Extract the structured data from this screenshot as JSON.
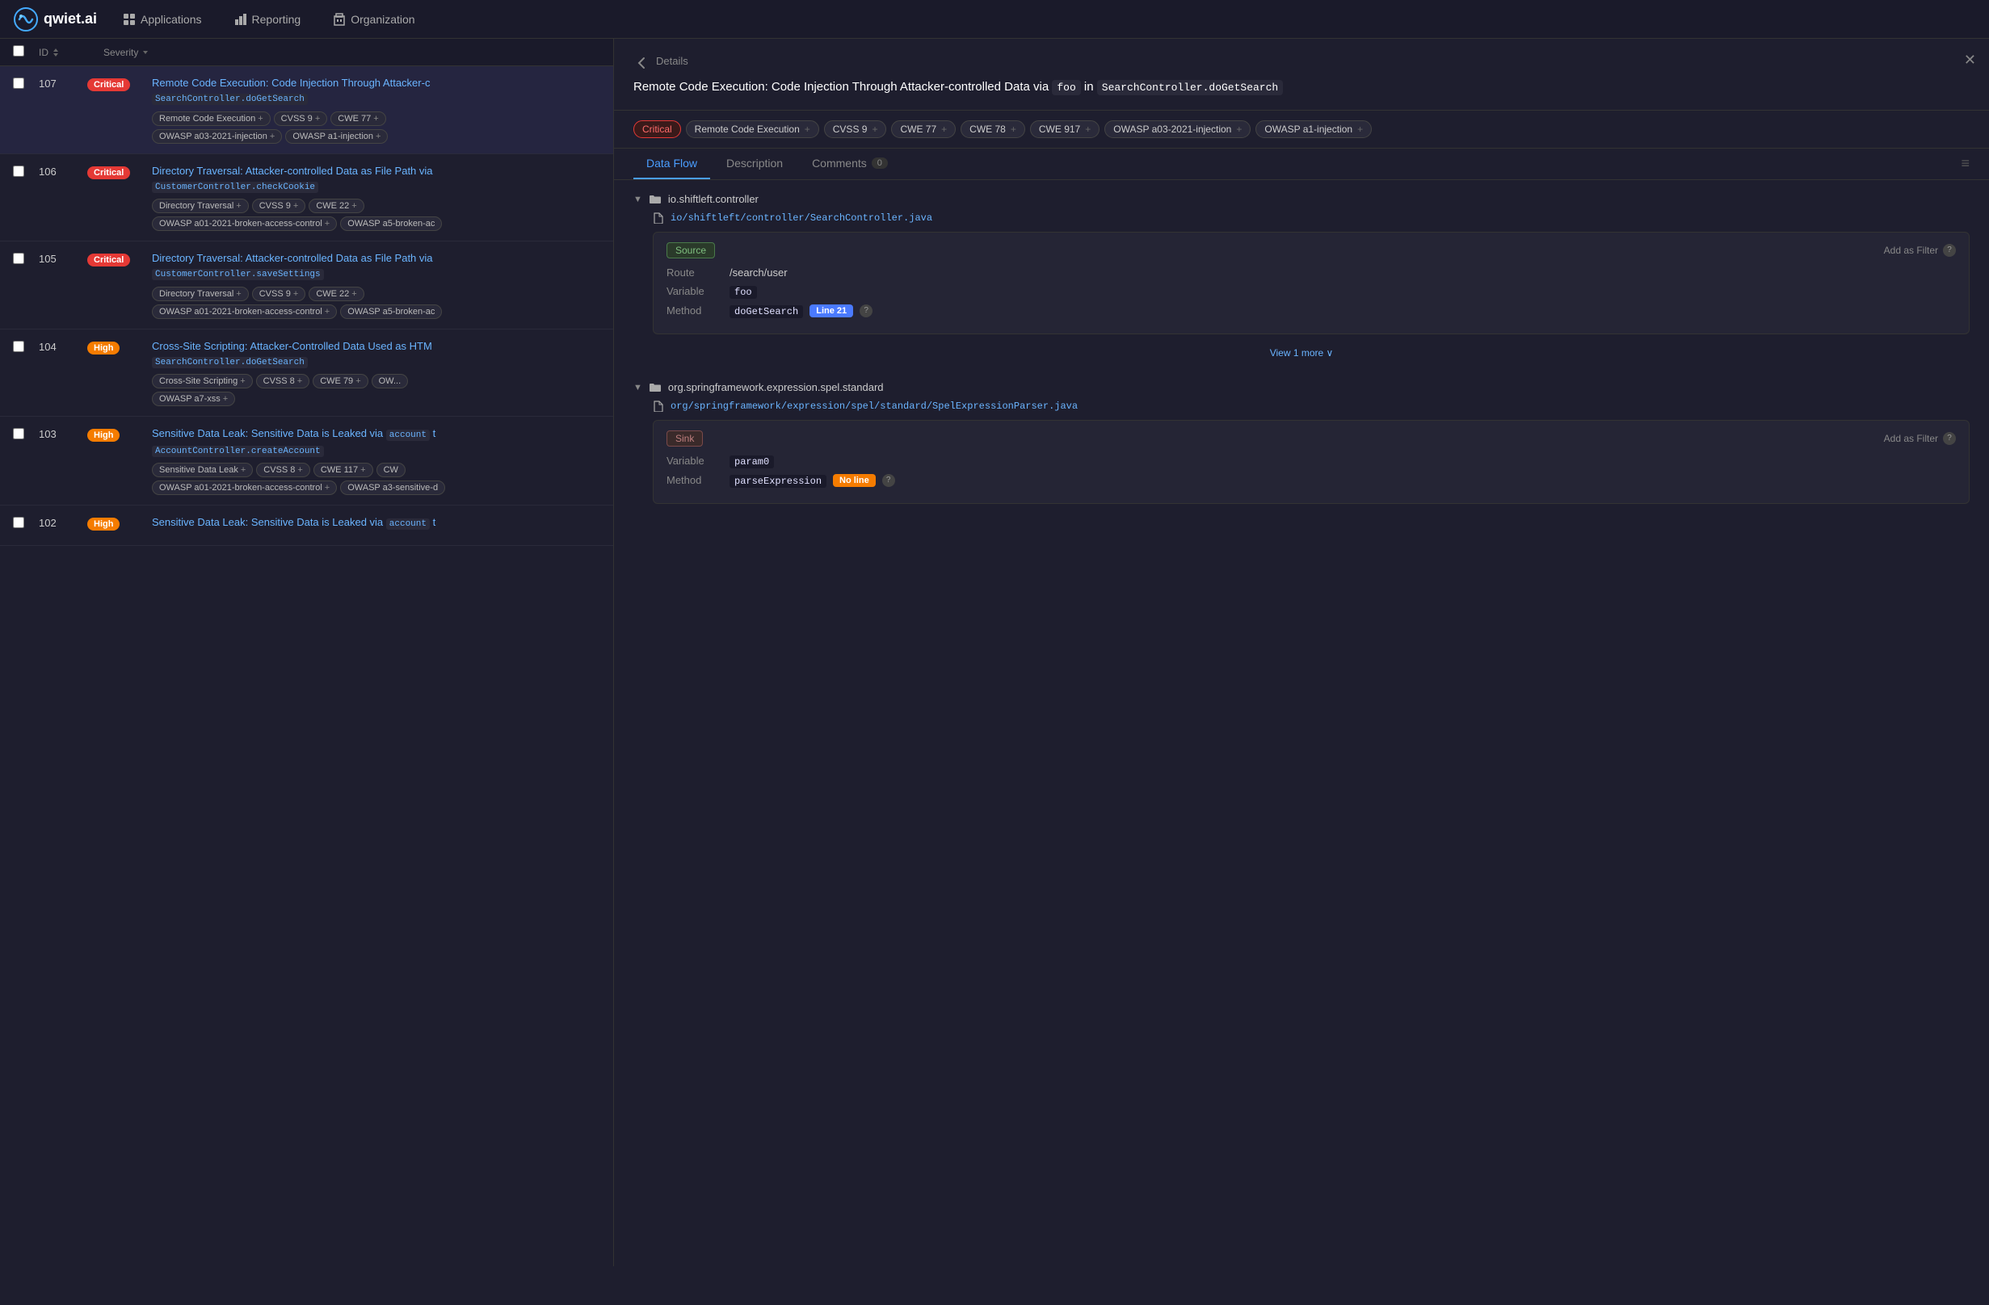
{
  "nav": {
    "logo_text": "qwiet.ai",
    "items": [
      {
        "label": "Applications",
        "icon": "grid-icon"
      },
      {
        "label": "Reporting",
        "icon": "bar-chart-icon"
      },
      {
        "label": "Organization",
        "icon": "building-icon"
      }
    ]
  },
  "table": {
    "headers": {
      "id": "ID",
      "severity": "Severity"
    },
    "rows": [
      {
        "id": "107",
        "severity": "Critical",
        "severity_class": "critical",
        "title": "Remote Code Execution: Code Injection Through Attacker-controlled Data via foo in SearchController.doGetSearch",
        "title_short": "Remote Code Execution: Code Injection Through Attacker-c",
        "code_part": "SearchController.doGetSearch",
        "tags": [
          "Remote Code Execution",
          "CVSS 9",
          "CWE 77",
          "OWASP a03-2021-injection",
          "OWASP a1-injection"
        ],
        "active": true
      },
      {
        "id": "106",
        "severity": "Critical",
        "severity_class": "critical",
        "title": "Directory Traversal: Attacker-controlled Data as File Path via CustomerController.checkCookie",
        "title_short": "Directory Traversal: Attacker-controlled Data as File Path via",
        "code_part": "CustomerController.checkCookie",
        "tags": [
          "Directory Traversal",
          "CVSS 9",
          "CWE 22",
          "OWASP a01-2021-broken-access-control",
          "OWASP a5-broken-ac"
        ],
        "active": false
      },
      {
        "id": "105",
        "severity": "Critical",
        "severity_class": "critical",
        "title": "Directory Traversal: Attacker-controlled Data as File Path via CustomerController.saveSettings",
        "title_short": "Directory Traversal: Attacker-controlled Data as File Path via",
        "code_part": "CustomerController.saveSettings",
        "tags": [
          "Directory Traversal",
          "CVSS 9",
          "CWE 22",
          "OWASP a01-2021-broken-access-control",
          "OWASP a5-broken-ac"
        ],
        "active": false
      },
      {
        "id": "104",
        "severity": "High",
        "severity_class": "high",
        "title": "Cross-Site Scripting: Attacker-Controlled Data Used as HTML via SearchController.doGetSearch",
        "title_short": "Cross-Site Scripting: Attacker-Controlled Data Used as HTM",
        "code_part": "SearchController.doGetSearch",
        "tags": [
          "Cross-Site Scripting",
          "CVSS 8",
          "CWE 79",
          "OWASP a7-xss"
        ],
        "active": false
      },
      {
        "id": "103",
        "severity": "High",
        "severity_class": "high",
        "title": "Sensitive Data Leak: Sensitive Data is Leaked via account to AccountController.createAccount",
        "title_short": "Sensitive Data Leak: Sensitive Data is Leaked via account t",
        "code_part": "AccountController.createAccount",
        "tags": [
          "Sensitive Data Leak",
          "CVSS 8",
          "CWE 117",
          "CW"
        ],
        "tags_row2": [
          "OWASP a01-2021-broken-access-control",
          "OWASP a3-sensitive-d"
        ],
        "active": false
      },
      {
        "id": "102",
        "severity": "High",
        "severity_class": "high",
        "title": "Sensitive Data Leak: Sensitive Data is Leaked via account to",
        "title_short": "Sensitive Data Leak: Sensitive Data is Leaked via account t",
        "code_part": "",
        "tags": [],
        "active": false
      }
    ]
  },
  "detail": {
    "back_label": "Details",
    "title_prefix": "Remote Code Execution: Code Injection Through Attacker-controlled Data via ",
    "title_code": "foo",
    "title_suffix": " in ",
    "title_method": "SearchController.doGetSearch",
    "tags": [
      "Critical",
      "Remote Code Execution",
      "CVSS 9",
      "CWE 77",
      "CWE 78",
      "CWE 917",
      "OWASP a03-2021-injection",
      "OWASP a1-injection"
    ],
    "tabs": [
      {
        "label": "Data Flow",
        "active": true
      },
      {
        "label": "Description",
        "active": false
      },
      {
        "label": "Comments",
        "count": "0",
        "active": false
      }
    ],
    "dataflow": {
      "sections": [
        {
          "folder": "io.shiftleft.controller",
          "file": "io/shiftleft/controller/SearchController.java",
          "card": {
            "type": "Source",
            "add_filter_label": "Add as Filter",
            "fields": [
              {
                "label": "Route",
                "value": "/search/user",
                "code": false
              },
              {
                "label": "Variable",
                "value": "foo",
                "code": true
              },
              {
                "label": "Method",
                "value": "doGetSearch",
                "code": true,
                "badge": "Line 21",
                "badge_type": "line"
              }
            ]
          },
          "view_more": "View 1 more"
        },
        {
          "folder": "org.springframework.expression.spel.standard",
          "file": "org/springframework/expression/spel/standard/SpelExpressionParser.java",
          "card": {
            "type": "Sink",
            "add_filter_label": "Add as Filter",
            "fields": [
              {
                "label": "Variable",
                "value": "param0",
                "code": true
              },
              {
                "label": "Method",
                "value": "parseExpression",
                "code": true,
                "badge": "No line",
                "badge_type": "no-line"
              }
            ]
          }
        }
      ]
    }
  }
}
